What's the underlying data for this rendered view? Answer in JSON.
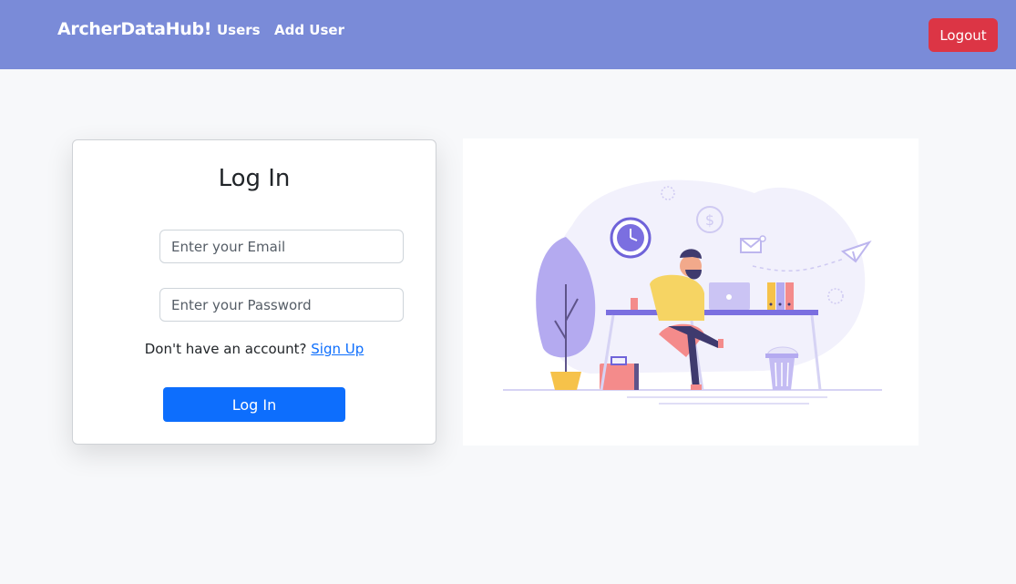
{
  "navbar": {
    "brand": "ArcherDataHub!",
    "links": [
      "Users",
      "Add User"
    ],
    "logout_label": "Logout"
  },
  "login": {
    "title": "Log In",
    "email_placeholder": "Enter your Email",
    "password_placeholder": "Enter your Password",
    "signup_prompt": "Don't have an account?",
    "signup_link": "Sign Up",
    "submit_label": "Log In"
  },
  "colors": {
    "navbar_bg": "#7a8bd8",
    "logout_bg": "#dc3545",
    "primary": "#0d6efd",
    "illustration_accent": "#7b6fe0"
  },
  "illustration": {
    "icons": [
      "clock-icon",
      "dollar-icon",
      "mail-icon",
      "paper-plane-icon",
      "laptop-icon",
      "plant-icon",
      "briefcase-icon",
      "trash-can-icon",
      "folders-icon"
    ]
  }
}
